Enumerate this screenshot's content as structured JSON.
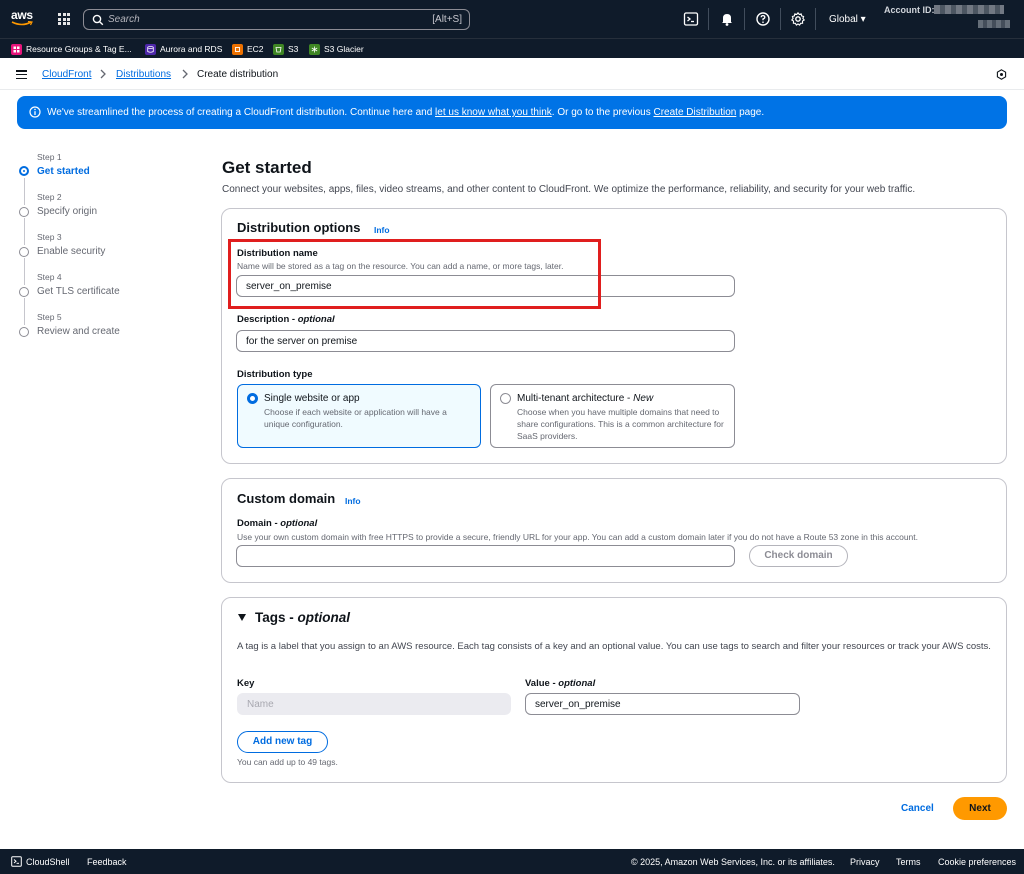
{
  "topnav": {
    "logo_text": "aws",
    "search_placeholder": "Search",
    "search_shortcut": "[Alt+S]",
    "region": "Global ▾",
    "account_label": "Account ID:"
  },
  "favorites": [
    {
      "label": "Resource Groups & Tag E...",
      "color": "#e7157b"
    },
    {
      "label": "Aurora and RDS",
      "color": "#4d27aa"
    },
    {
      "label": "EC2",
      "color": "#ed7100"
    },
    {
      "label": "S3",
      "color": "#3f8624"
    },
    {
      "label": "S3 Glacier",
      "color": "#3f8624"
    }
  ],
  "breadcrumb": {
    "items": [
      "CloudFront",
      "Distributions",
      "Create distribution"
    ]
  },
  "banner": {
    "text_1": "We've streamlined the process of creating a CloudFront distribution. Continue here and ",
    "link_1": "let us know what you think",
    "text_2": ". Or go to the previous ",
    "link_2": "Create Distribution",
    "text_3": " page."
  },
  "steps": [
    {
      "num": "Step 1",
      "label": "Get started"
    },
    {
      "num": "Step 2",
      "label": "Specify origin"
    },
    {
      "num": "Step 3",
      "label": "Enable security"
    },
    {
      "num": "Step 4",
      "label": "Get TLS certificate"
    },
    {
      "num": "Step 5",
      "label": "Review and create"
    }
  ],
  "main": {
    "title": "Get started",
    "description": "Connect your websites, apps, files, video streams, and other content to CloudFront. We optimize the performance, reliability, and security for your web traffic."
  },
  "distribution_options": {
    "title": "Distribution options",
    "info": "Info",
    "name_label": "Distribution name",
    "name_desc": "Name will be stored as a tag on the resource. You can add a name, or more tags, later.",
    "name_value": "server_on_premise",
    "description_label": "Description - ",
    "description_optional": "optional",
    "description_value": "for the server on premise",
    "type_label": "Distribution type",
    "single_title": "Single website or app",
    "single_desc": "Choose if each website or application will have a unique configuration.",
    "multi_title": "Multi-tenant architecture - ",
    "multi_new": "New",
    "multi_desc": "Choose when you have multiple domains that need to share configurations. This is a common architecture for SaaS providers."
  },
  "custom_domain": {
    "title": "Custom domain",
    "info": "Info",
    "domain_label": "Domain - ",
    "domain_optional": "optional",
    "domain_desc": "Use your own custom domain with free HTTPS to provide a secure, friendly URL for your app. You can add a custom domain later if you do not have a Route 53 zone in this account.",
    "domain_value": "",
    "check_button": "Check domain"
  },
  "tags": {
    "title": "Tags - ",
    "title_optional": "optional",
    "description": "A tag is a label that you assign to an AWS resource. Each tag consists of a key and an optional value. You can use tags to search and filter your resources or track your AWS costs.",
    "key_label": "Key",
    "value_label": "Value - ",
    "value_optional": "optional",
    "key_placeholder": "Name",
    "value_value": "server_on_premise",
    "add_button": "Add new tag",
    "limit_text": "You can add up to 49 tags."
  },
  "actions": {
    "cancel": "Cancel",
    "next": "Next"
  },
  "footer": {
    "cloudshell": "CloudShell",
    "feedback": "Feedback",
    "copyright": "© 2025, Amazon Web Services, Inc. or its affiliates.",
    "privacy": "Privacy",
    "terms": "Terms",
    "cookies": "Cookie preferences"
  }
}
